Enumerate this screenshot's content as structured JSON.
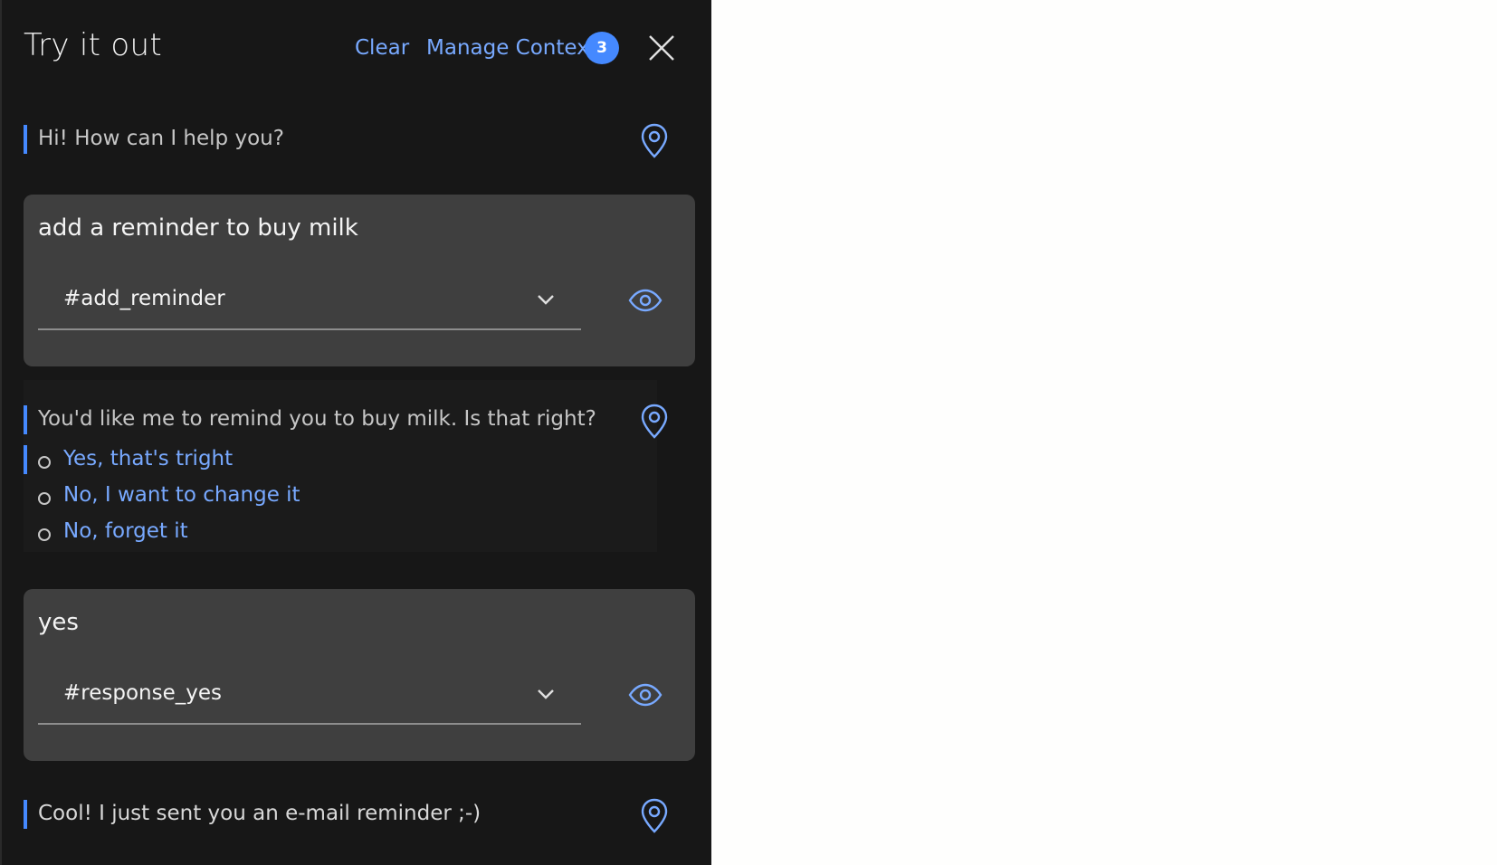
{
  "header": {
    "title": "Try it out",
    "clear_label": "Clear",
    "manage_context_label": "Manage Context",
    "context_count": "3"
  },
  "conversation": {
    "bot_greeting": "Hi! How can I help you?",
    "user_message_1": "add a reminder to buy milk",
    "intent_1": "#add_reminder",
    "bot_confirm": "You'd like me to remind you to buy milk. Is that right?",
    "options": [
      "Yes, that's tright",
      "No, I want to change it",
      "No, forget it"
    ],
    "user_message_2": "yes",
    "intent_2": "#response_yes",
    "bot_final": "Cool! I just sent you an e-mail reminder ;-)"
  },
  "colors": {
    "panel_bg": "#171717",
    "card_bg": "#3f3f3f",
    "accent": "#4589ff",
    "link": "#78a9ff"
  },
  "icons": {
    "close": "close-icon",
    "location": "location-pin-icon",
    "eye": "eye-icon",
    "chevron": "chevron-down-icon"
  }
}
